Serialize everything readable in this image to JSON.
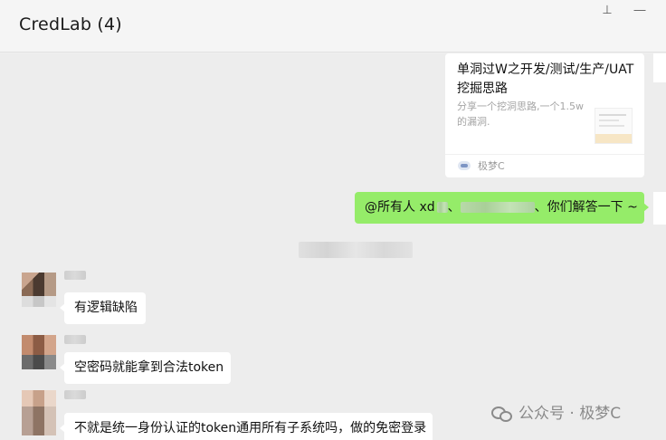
{
  "window": {
    "title": "CredLab (4)",
    "pin_icon": "pin-icon",
    "minimize_icon": "minimize-icon",
    "pin_glyph": "⊥",
    "minimize_glyph": "—"
  },
  "messages": {
    "link_card": {
      "title": "单洞过W之开发/测试/生产/UAT挖掘思路",
      "description": "分享一个挖洞思路,一个1.5w的漏洞.",
      "source": "极梦C"
    },
    "my_message": {
      "prefix": "@所有人 xd",
      "suffix": "、你们解答一下 ~"
    },
    "incoming": [
      {
        "text": "有逻辑缺陷"
      },
      {
        "text": "空密码就能拿到合法token"
      },
      {
        "text": "不就是统一身份认证的token通用所有子系统吗，做的免密登录"
      }
    ]
  },
  "watermark": {
    "text": "公众号 · 极梦C"
  },
  "colors": {
    "outgoing_bubble": "#95ec69",
    "incoming_bubble": "#ffffff",
    "chat_background": "#ededed"
  }
}
